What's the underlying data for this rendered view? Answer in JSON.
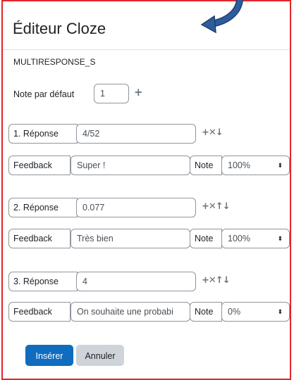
{
  "dialog": {
    "title": "Éditeur Cloze",
    "question_type": "MULTIRESPONSE_S"
  },
  "default_mark": {
    "label": "Note par défaut",
    "value": "1"
  },
  "answers": [
    {
      "answer_label": "1. Réponse",
      "answer_value": "4/52",
      "feedback_label": "Feedback",
      "feedback_value": "Super !",
      "grade_label": "Note",
      "grade_value": "100%"
    },
    {
      "answer_label": "2. Réponse",
      "answer_value": "0.077",
      "feedback_label": "Feedback",
      "feedback_value": "Très bien",
      "grade_label": "Note",
      "grade_value": "100%"
    },
    {
      "answer_label": "3. Réponse",
      "answer_value": "4",
      "feedback_label": "Feedback",
      "feedback_value": "On souhaite une probabi",
      "grade_label": "Note",
      "grade_value": "0%"
    }
  ],
  "buttons": {
    "insert": "Insérer",
    "cancel": "Annuler"
  },
  "icons": {
    "plus": "+",
    "delete": "✕",
    "up": "↑",
    "down": "↓",
    "select_caret": "⬍"
  },
  "colors": {
    "primary": "#0f6cbf",
    "secondary": "#ced4da",
    "frame": "#e0262b",
    "arrow": "#2e5c9e"
  }
}
